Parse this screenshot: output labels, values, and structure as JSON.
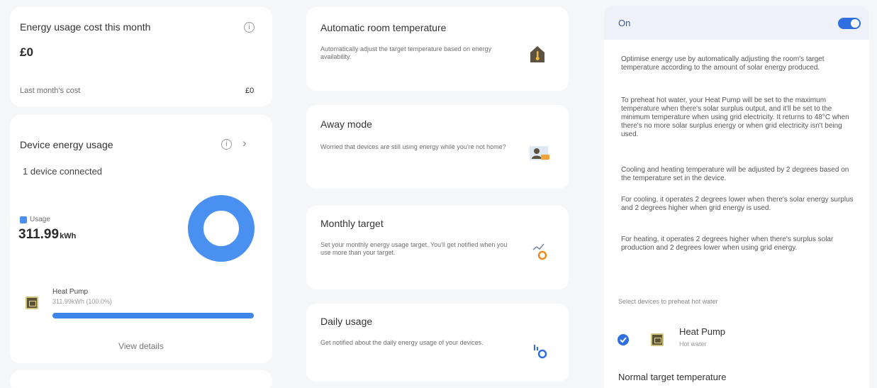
{
  "cost": {
    "title": "Energy usage cost this month",
    "value": "£0",
    "last_month_label": "Last month's cost",
    "last_month_value": "£0"
  },
  "device_usage": {
    "title": "Device energy usage",
    "connected": "1 device connected",
    "legend_label": "Usage",
    "total_value": "311.99",
    "total_unit": "kWh",
    "donut_fraction": 1.0,
    "accent": "#4a90f0",
    "device": {
      "name": "Heat Pump",
      "detail": "311.99kWh (100.0%)",
      "bar_fraction": 1.0
    },
    "view_details": "View details"
  },
  "features": [
    {
      "title": "Automatic room temperature",
      "desc": "Automatically adjust the target temperature based on energy availability.",
      "icon": "house-thermometer-icon"
    },
    {
      "title": "Away mode",
      "desc": "Worried that devices are still using energy while you're not home?",
      "icon": "away-person-icon"
    },
    {
      "title": "Monthly target",
      "desc": "Set your monthly energy usage target. You'll get notified when you use more than your target.",
      "icon": "target-chart-icon"
    },
    {
      "title": "Daily usage",
      "desc": "Get notified about the daily energy usage of your devices.",
      "icon": "daily-chart-icon"
    }
  ],
  "detail": {
    "on_label": "On",
    "toggle_on": true,
    "paragraphs": [
      "Optimise energy use by automatically adjusting the room's target temperature according to the amount of solar energy produced.",
      "To preheat hot water, your Heat Pump will be set to the maximum temperature when there's solar surplus output, and it'll be set to the minimum temperature when using grid electricity. It returns to 48°C when there's no more solar surplus energy or when grid electricity isn't being used.",
      "Cooling and heating temperature will be adjusted by 2 degrees based on the temperature set in the device.",
      "For cooling, it operates 2 degrees lower when there's solar energy surplus and 2 degrees higher when grid energy is used.",
      "For heating, it operates 2 degrees higher when there's surplus solar production and 2 degrees lower when using grid energy."
    ],
    "select_label": "Select devices to preheat hot water",
    "device_name": "Heat Pump",
    "device_sub": "Hot water",
    "normal_target": "Normal target temperature"
  }
}
